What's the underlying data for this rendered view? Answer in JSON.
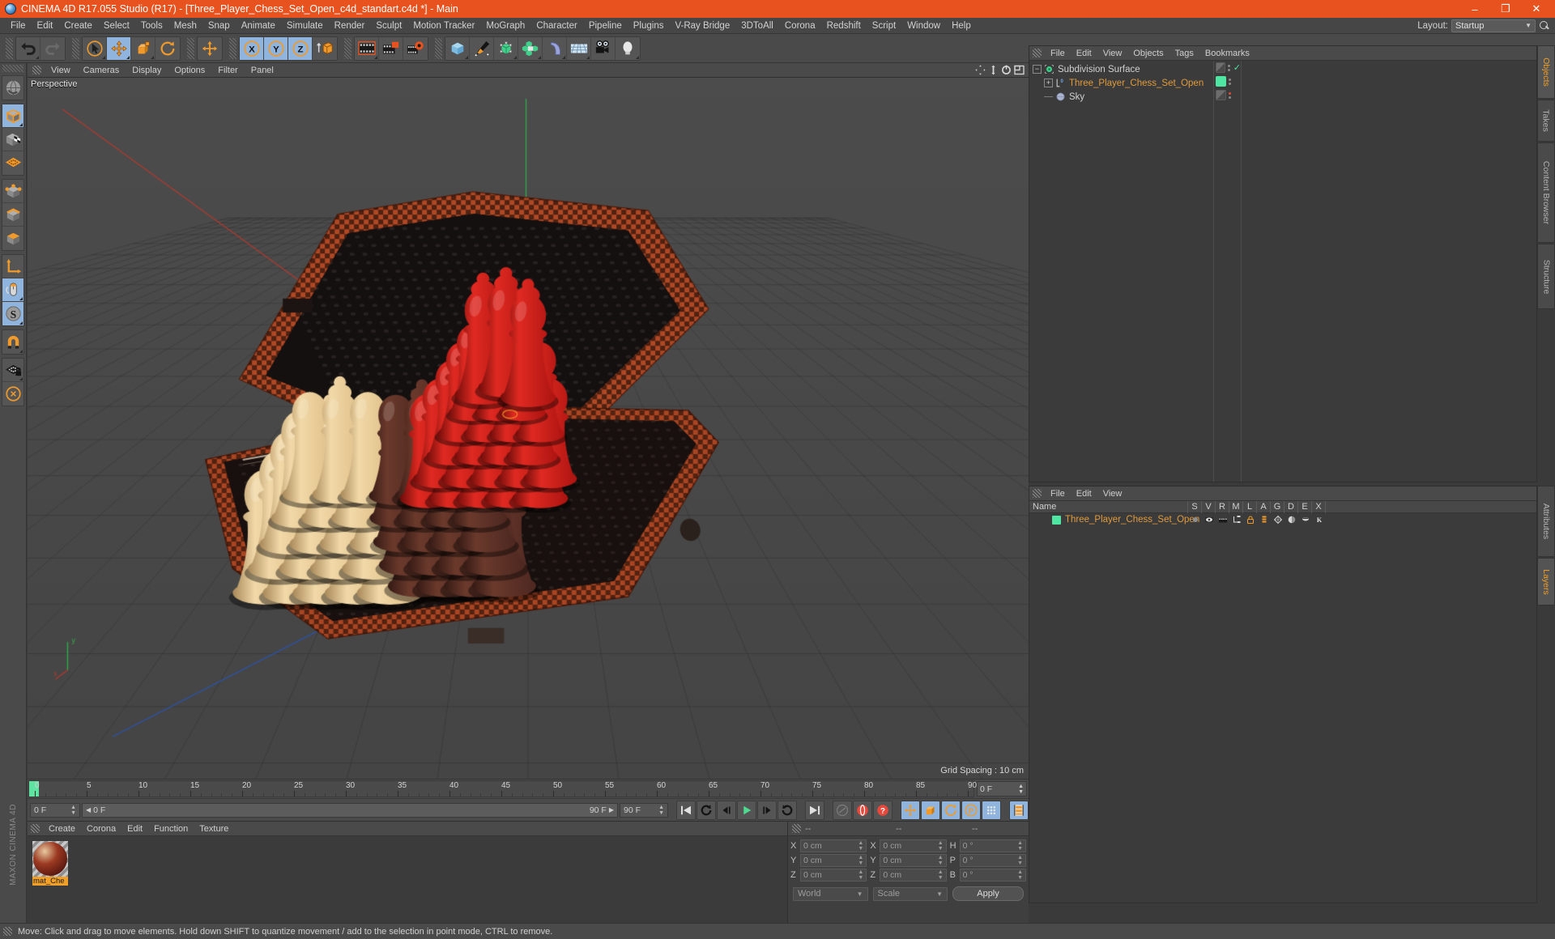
{
  "window": {
    "title": "CINEMA 4D R17.055 Studio (R17) - [Three_Player_Chess_Set_Open_c4d_standart.c4d *] - Main",
    "minimize": "–",
    "maximize": "❐",
    "close": "✕"
  },
  "menubar": {
    "items": [
      "File",
      "Edit",
      "Create",
      "Select",
      "Tools",
      "Mesh",
      "Snap",
      "Animate",
      "Simulate",
      "Render",
      "Sculpt",
      "Motion Tracker",
      "MoGraph",
      "Character",
      "Pipeline",
      "Plugins",
      "V-Ray Bridge",
      "3DToAll",
      "Corona",
      "Redshift",
      "Script",
      "Window",
      "Help"
    ],
    "layout_label": "Layout:",
    "layout_value": "Startup"
  },
  "toolbar": {
    "groups": [
      {
        "name": "history",
        "buttons": [
          {
            "icon": "undo-icon",
            "label": "Undo",
            "active": false
          },
          {
            "icon": "redo-icon",
            "label": "Redo",
            "active": false
          }
        ]
      },
      {
        "name": "transform",
        "buttons": [
          {
            "icon": "select-cursor-icon",
            "label": "Live Selection",
            "active": false
          },
          {
            "icon": "move-icon",
            "label": "Move",
            "active": true
          },
          {
            "icon": "scale-icon",
            "label": "Scale",
            "active": false
          },
          {
            "icon": "rotate-icon",
            "label": "Rotate",
            "active": false
          }
        ]
      },
      {
        "name": "world-axis",
        "buttons": [
          {
            "icon": "axis-move-icon",
            "label": "World/Object Axis",
            "active": false
          }
        ]
      },
      {
        "name": "axis-locks",
        "buttons": [
          {
            "icon": "x-axis-icon",
            "label": "X Axis",
            "active": true
          },
          {
            "icon": "y-axis-icon",
            "label": "Y Axis",
            "active": true
          },
          {
            "icon": "z-axis-icon",
            "label": "Z Axis",
            "active": true
          },
          {
            "icon": "world-coordinate-icon",
            "label": "World Coordinate System",
            "active": false
          }
        ]
      },
      {
        "name": "render",
        "buttons": [
          {
            "icon": "render-view-icon",
            "label": "Render View",
            "active": false
          },
          {
            "icon": "render-picture-viewer-icon",
            "label": "Render to Picture Viewer",
            "active": false
          },
          {
            "icon": "render-settings-icon",
            "label": "Edit Render Settings",
            "active": false
          }
        ]
      },
      {
        "name": "objects",
        "buttons": [
          {
            "icon": "cube-primitive-icon",
            "label": "Add Cube Object",
            "active": false
          },
          {
            "icon": "pen-spline-icon",
            "label": "Add Spline Object",
            "active": false
          },
          {
            "icon": "generator-icon",
            "label": "Add Generator Object",
            "active": false
          },
          {
            "icon": "array-icon",
            "label": "Add Modeling Object",
            "active": false
          },
          {
            "icon": "bend-deformer-icon",
            "label": "Add Deformation Object",
            "active": false
          },
          {
            "icon": "environment-icon",
            "label": "Add Scene Object",
            "active": false
          },
          {
            "icon": "camera-icon",
            "label": "Add Camera Object",
            "active": false
          },
          {
            "icon": "light-icon",
            "label": "Add Light Object",
            "active": false
          }
        ]
      }
    ]
  },
  "leftbar": {
    "groups": [
      {
        "buttons": [
          {
            "icon": "undo-view-icon",
            "label": "Undo View",
            "active": false
          }
        ]
      },
      {
        "buttons": [
          {
            "icon": "model-mode-icon",
            "label": "Model Mode",
            "active": true
          },
          {
            "icon": "texture-mode-icon",
            "label": "Texture Mode",
            "active": false
          },
          {
            "icon": "workplane-icon",
            "label": "Workplane",
            "active": false
          }
        ]
      },
      {
        "buttons": [
          {
            "icon": "points-mode-icon",
            "label": "Points Mode",
            "active": false
          },
          {
            "icon": "edges-mode-icon",
            "label": "Edges Mode",
            "active": false
          },
          {
            "icon": "polygons-mode-icon",
            "label": "Polygons Mode",
            "active": false
          }
        ]
      },
      {
        "buttons": [
          {
            "icon": "axis-modify-icon",
            "label": "Enable Axis Modification",
            "active": false
          },
          {
            "icon": "viewport-solo-icon",
            "label": "Enable Viewport Solo",
            "active": true
          },
          {
            "icon": "soft-selection-icon",
            "label": "Soft Selection",
            "active": true
          }
        ]
      },
      {
        "buttons": [
          {
            "icon": "magnet-icon",
            "label": "Magnet",
            "active": false
          }
        ]
      },
      {
        "buttons": [
          {
            "icon": "snap-lock-icon",
            "label": "Enable Snapping",
            "active": false
          },
          {
            "icon": "workplane-lock-icon",
            "label": "Lock Workplane",
            "active": false
          }
        ]
      }
    ],
    "maxon_text": "MAXON CINEMA 4D"
  },
  "viewport": {
    "menu": [
      "View",
      "Cameras",
      "Display",
      "Options",
      "Filter",
      "Panel"
    ],
    "label": "Perspective",
    "grid_spacing": "Grid Spacing : 10 cm",
    "icons": [
      "pan-view-icon",
      "dolly-view-icon",
      "rotate-view-icon",
      "maximize-view-icon"
    ],
    "scene": {
      "description": "Three player hexagonal chess set in an open wooden case, viewed in perspective",
      "piece_sets": [
        "cream",
        "red",
        "dark"
      ],
      "case_color": "#8a3a20",
      "board_color": "#171211"
    }
  },
  "timeline": {
    "ticks": [
      "0",
      "5",
      "10",
      "15",
      "20",
      "25",
      "30",
      "35",
      "40",
      "45",
      "50",
      "55",
      "60",
      "65",
      "70",
      "75",
      "80",
      "85",
      "90"
    ],
    "current_frame_field": "0 F",
    "end_field": "0 F",
    "scrub_start": "0 F",
    "scrub_end": "90 F",
    "range_end": "90 F",
    "playhead_frame": 0
  },
  "transport": {
    "buttons": [
      {
        "icon": "go-to-start-icon",
        "label": "Go To Start",
        "active": false
      },
      {
        "icon": "previous-key-icon",
        "label": "Go To Previous Key",
        "active": false
      },
      {
        "icon": "step-back-icon",
        "label": "Go To Previous Frame",
        "active": false
      },
      {
        "icon": "play-icon",
        "label": "Play Forwards",
        "active": false
      },
      {
        "icon": "step-forward-icon",
        "label": "Go To Next Frame",
        "active": false
      },
      {
        "icon": "next-key-icon",
        "label": "Go To Next Key",
        "active": false
      },
      {
        "icon": "go-to-end-icon",
        "label": "Go To End",
        "active": false
      },
      {
        "icon": "autokey-record-icon",
        "label": "Record Active Objects",
        "active": false
      },
      {
        "icon": "autokeying-icon",
        "label": "Autokeying",
        "active": false
      },
      {
        "icon": "keyframe-selection-icon",
        "label": "Keyframe Selection",
        "active": false
      },
      {
        "icon": "key-position-icon",
        "label": "Position",
        "active": true
      },
      {
        "icon": "key-scale-icon",
        "label": "Scale",
        "active": true
      },
      {
        "icon": "key-rotation-icon",
        "label": "Rotation",
        "active": true
      },
      {
        "icon": "key-parameter-icon",
        "label": "Parameter",
        "active": true
      },
      {
        "icon": "key-pla-icon",
        "label": "Point Level Animation",
        "active": true
      },
      {
        "icon": "timeline-mode-icon",
        "label": "Animation Mode",
        "active": true
      }
    ]
  },
  "materials": {
    "menu": [
      "Create",
      "Corona",
      "Edit",
      "Function",
      "Texture"
    ],
    "items": [
      {
        "name": "mat_Che",
        "selected": true
      }
    ]
  },
  "coordinates": {
    "header": [
      "--",
      "--",
      "--"
    ],
    "rows": [
      {
        "label_pos": "X",
        "value_pos": "0 cm",
        "label_size": "X",
        "value_size": "0 cm",
        "label_rot": "H",
        "value_rot": "0 °"
      },
      {
        "label_pos": "Y",
        "value_pos": "0 cm",
        "label_size": "Y",
        "value_size": "0 cm",
        "label_rot": "P",
        "value_rot": "0 °"
      },
      {
        "label_pos": "Z",
        "value_pos": "0 cm",
        "label_size": "Z",
        "value_size": "0 cm",
        "label_rot": "B",
        "value_rot": "0 °"
      }
    ],
    "system": "World",
    "mode": "Scale",
    "apply": "Apply"
  },
  "object_manager": {
    "menu": [
      "File",
      "Edit",
      "View",
      "Objects",
      "Tags",
      "Bookmarks"
    ],
    "rows": [
      {
        "name": "Subdivision Surface",
        "icon": "subdivision-surface-icon",
        "depth": 0,
        "expander": "−",
        "swatch": "half",
        "check": true,
        "dot": null
      },
      {
        "name": "Three_Player_Chess_Set_Open",
        "icon": "null-object-icon",
        "depth": 1,
        "expander": "+",
        "swatch": "green",
        "check": false,
        "dot": null
      },
      {
        "name": "Sky",
        "icon": "sky-object-icon",
        "depth": 1,
        "expander": "",
        "swatch": "half",
        "check": false,
        "dot": "#e04a3c"
      }
    ]
  },
  "attribute_manager": {
    "menu": [
      "File",
      "Edit",
      "View"
    ],
    "columns": [
      "Name",
      "S",
      "V",
      "R",
      "M",
      "L",
      "A",
      "G",
      "D",
      "E",
      "X"
    ],
    "rows": [
      {
        "name": "Three_Player_Chess_Set_Open",
        "swatch": "#4fe5a2",
        "tags": [
          "dot-tag-icon",
          "display-tag-icon",
          "render-tag-icon",
          "hierarchy-tag-icon",
          "lock-tag-icon",
          "layer-tag-icon",
          "deform-tag-icon",
          "shadow-tag-icon",
          "cast-tag-icon",
          "motion-tag-icon"
        ]
      }
    ]
  },
  "side_tabs": {
    "top": [
      {
        "label": "Objects",
        "active": true
      },
      {
        "label": "Takes",
        "active": false
      },
      {
        "label": "Content Browser",
        "active": false
      },
      {
        "label": "Structure",
        "active": false
      }
    ],
    "bottom": [
      {
        "label": "Attributes",
        "active": false
      },
      {
        "label": "Layers",
        "active": true
      }
    ]
  },
  "statusbar": {
    "message": "Move: Click and drag to move elements. Hold down SHIFT to quantize movement / add to the selection in point mode, CTRL to remove."
  },
  "colors": {
    "title_accent": "#e8521e",
    "panel_bg": "#3f3f3f",
    "toolbar_bg": "#4a4a4a",
    "active_blue": "#8fb4dd",
    "orange_text": "#e09a3c",
    "green_swatch": "#4fe5a2"
  }
}
